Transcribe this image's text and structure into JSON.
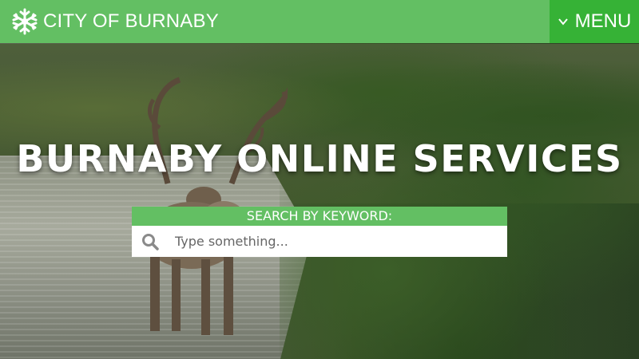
{
  "header": {
    "logo_icon": "snowflake-logo-icon",
    "logo_text": "CITY OF BURNABY",
    "menu_icon": "chevron-down-icon",
    "menu_label": "MENU",
    "colors": {
      "header_bg": "#63bf63",
      "menu_bg": "#36b236"
    }
  },
  "hero": {
    "title": "BURNABY ONLINE SERVICES",
    "background_image": "caribou-in-river-photo"
  },
  "search": {
    "label": "SEARCH BY KEYWORD:",
    "icon": "search-icon",
    "placeholder": "Type something...",
    "value": ""
  }
}
